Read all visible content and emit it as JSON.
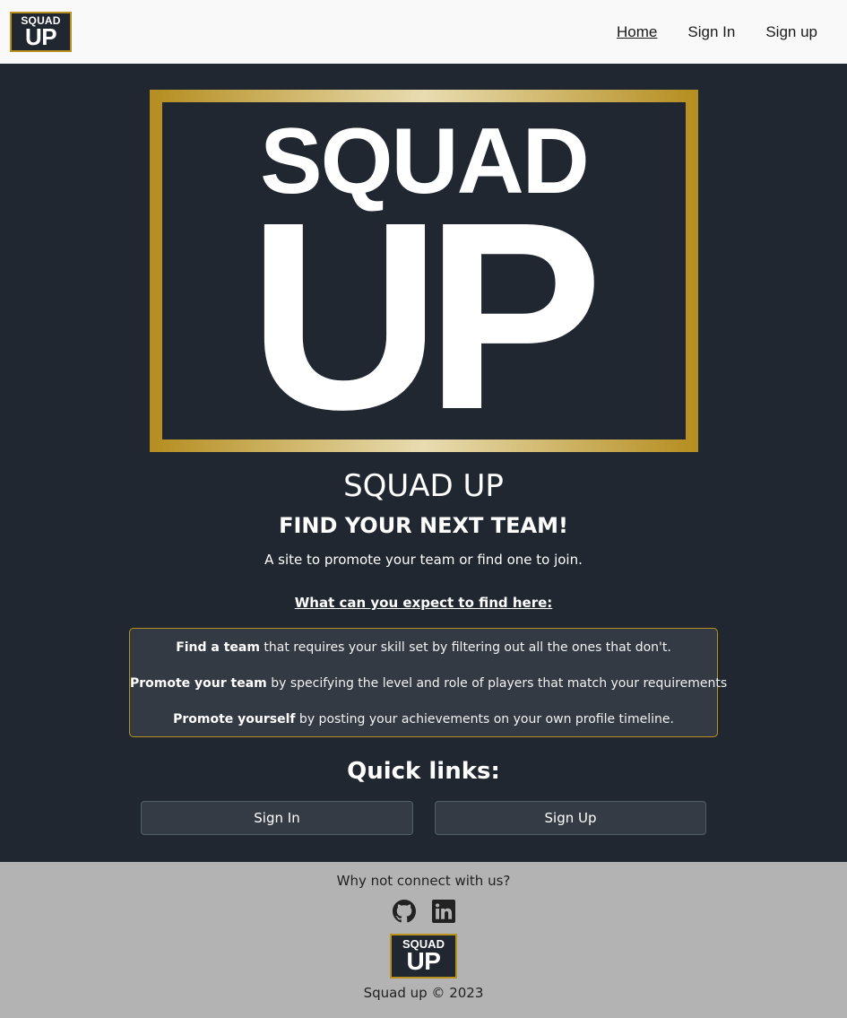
{
  "navbar": {
    "logo": {
      "line1": "SQUAD",
      "line2": "UP"
    },
    "links": [
      {
        "label": "Home",
        "active": true
      },
      {
        "label": "Sign In",
        "active": false
      },
      {
        "label": "Sign up",
        "active": false
      }
    ]
  },
  "hero": {
    "logo": {
      "line1": "SQUAD",
      "line2": "UP"
    },
    "title": "SQUAD UP",
    "subtitle": "FIND YOUR NEXT TEAM!",
    "tagline": "A site to promote your team or find one to join.",
    "expect_heading": "What can you expect to find here:"
  },
  "features": [
    {
      "bold": "Find a team",
      "text": " that requires your skill set by filtering out all the ones that don't."
    },
    {
      "bold": "Promote your team",
      "text": " by specifying the level and role of players that match your requirements"
    },
    {
      "bold": "Promote yourself",
      "text": " by posting your achievements on your own profile timeline."
    }
  ],
  "quick_links": {
    "heading": "Quick links:",
    "signin_label": "Sign In",
    "signup_label": "Sign Up"
  },
  "footer": {
    "connect_text": "Why not connect with us?",
    "icons": [
      "github-icon",
      "linkedin-icon"
    ],
    "logo": {
      "line1": "SQUAD",
      "line2": "UP"
    },
    "copyright": "Squad up © 2023"
  },
  "colors": {
    "background": "#212731",
    "navbar": "#f9f9f9",
    "gold_accent": "#b8901e",
    "footer": "#b3b3b3"
  }
}
